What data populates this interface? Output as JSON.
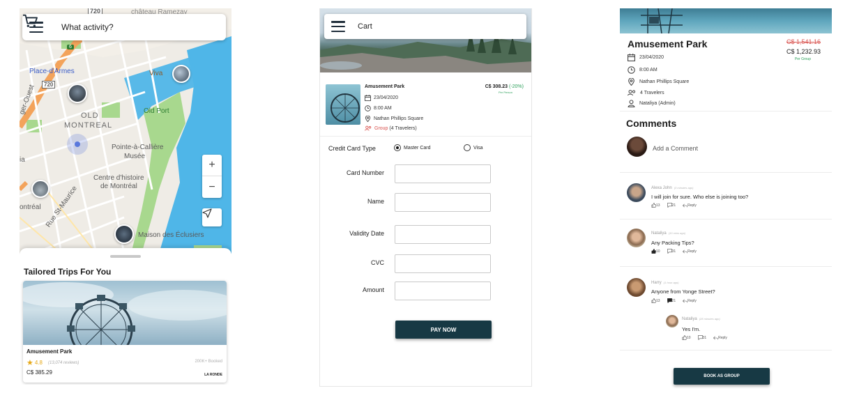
{
  "map_screen": {
    "search_placeholder": "What activity?",
    "map_labels": {
      "place_darmes": "Place-d'Armes",
      "old_montreal_1": "OLD",
      "old_montreal_2": "MONTREAL",
      "viva": "Viva",
      "old_port": "Old Port",
      "pointe": "Pointe-à-Callière",
      "musee": "Musée",
      "centre1": "Centre d'histoire",
      "centre2": "de Montréal",
      "ontreal": "ontréal",
      "rue_st_maurice": "Rue St-Maurice",
      "maison": "Maison des Éclusiers",
      "route_720_a": "720",
      "route_720_b": "720",
      "route_6": "6",
      "chateau": "château Ramezay",
      "quest": "ger-Ouest",
      "ia": "ia"
    },
    "zoom_in": "+",
    "zoom_out": "−",
    "sheet_title": "Tailored Trips For You",
    "trip": {
      "title": "Amusement Park",
      "rating": "4.8",
      "reviews": "(13,074 reviews)",
      "booked": "200K+ Booked",
      "price": "C$ 385.29",
      "brand": "LA RONDE"
    }
  },
  "cart_screen": {
    "title": "Cart",
    "item": {
      "title": "Amusement Park",
      "date": "23/04/2020",
      "time": "8:00 AM",
      "location": "Nathan Phillips Square",
      "group": "Group",
      "travelers": "(4 Travelers)",
      "price": "C$ 308.23",
      "discount": "(-20%)",
      "per": "Per Person"
    },
    "form": {
      "credit_card_type": "Credit Card Type",
      "option_master": "Master Card",
      "option_visa": "Visa",
      "card_number": "Card Number",
      "name": "Name",
      "validity_date": "Validity Date",
      "cvc": "CVC",
      "amount": "Amount"
    },
    "pay_button": "PAY NOW"
  },
  "detail_screen": {
    "title": "Amusement Park",
    "old_price": "C$ 1,541.16",
    "new_price": "C$ 1,232.93",
    "per_group": "Per Group",
    "date": "23/04/2020",
    "time": "8:00 AM",
    "location": "Nathan Phillips Square",
    "travelers": "4 Travelers",
    "admin": "Nataliya (Admin)",
    "comments_title": "Comments",
    "add_comment": "Add a Comment",
    "comments": [
      {
        "name": "Alexa John",
        "ago": "(3 minutes ago)",
        "text": "I will join for sure. Who else is joining too?",
        "likes": "13",
        "replies": "21",
        "reply": "Reply"
      },
      {
        "name": "Nataliya",
        "ago": "(10 mins ago)",
        "text": "Any Packing Tips?",
        "likes": "10",
        "replies": "31",
        "reply": "Reply"
      },
      {
        "name": "Harry",
        "ago": "(1 hour ago)",
        "text": "Anyone from Yonge Street?",
        "likes": "13",
        "replies": "21",
        "reply": "Reply"
      },
      {
        "name": "Nataliya",
        "ago": "(28 minutes ago)",
        "text": "Yes I'm.",
        "likes": "10",
        "replies": "31",
        "reply": "Reply"
      }
    ],
    "book_button": "BOOK AS GROUP"
  },
  "colors": {
    "primary_dark": "#173944",
    "accent_green": "#2ca05a",
    "price_red": "#d9534f",
    "star": "#e6a817",
    "water": "#4fb6e8",
    "park": "#a8d88e"
  },
  "icons": [
    "hamburger-menu-icon",
    "cart-icon",
    "navigate-icon",
    "calendar-icon",
    "clock-icon",
    "location-pin-icon",
    "group-icon",
    "person-icon",
    "star-icon",
    "thumbs-up-icon",
    "comment-icon",
    "reply-icon"
  ]
}
